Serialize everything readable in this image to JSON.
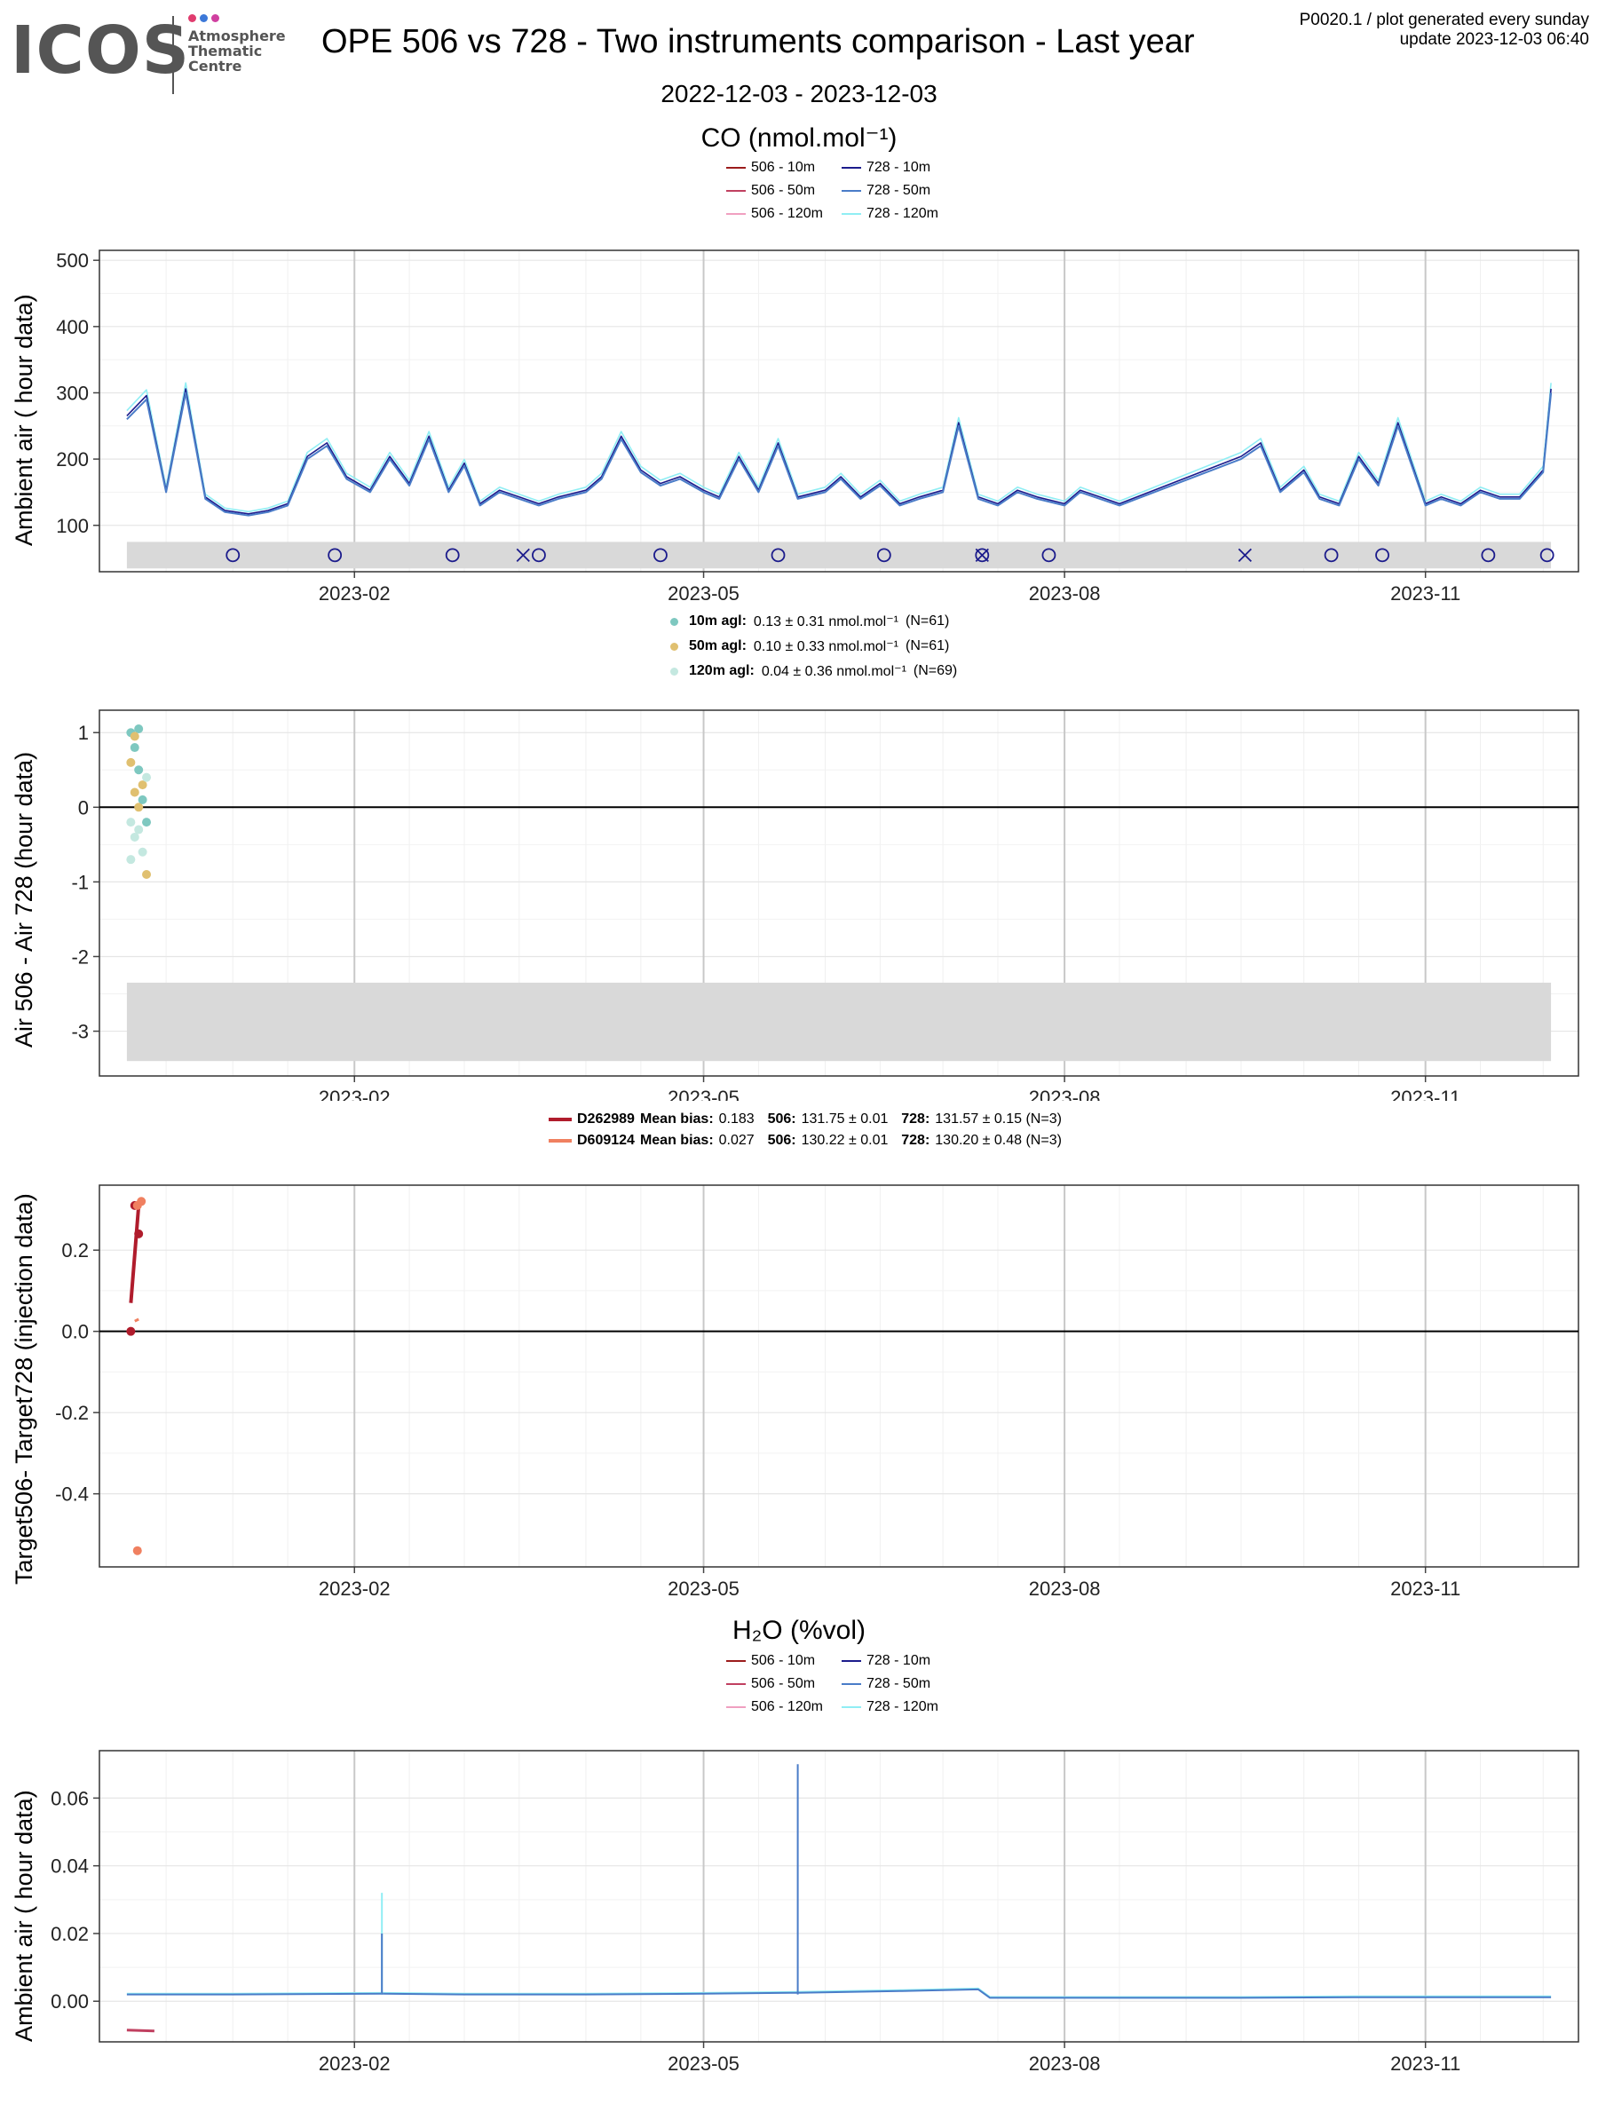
{
  "header": {
    "logo": "ICOS",
    "logo_sub": [
      "Atmosphere",
      "Thematic",
      "Centre"
    ],
    "logo_dot_colors": [
      "#e03c6e",
      "#3c78d8",
      "#d040a0"
    ],
    "title": "OPE 506 vs 728 - Two instruments comparison - Last year",
    "date_range": "2022-12-03 - 2023-12-03",
    "meta_line1": "P0020.1 / plot generated every sunday",
    "meta_line2": "update  2023-12-03 06:40"
  },
  "chart_data": [
    {
      "id": "co-ambient",
      "type": "line",
      "title": "CO (nmol.mol⁻¹)",
      "ylabel": "Ambient air ( hour data)",
      "ylim": [
        30,
        515
      ],
      "yticks": [
        100,
        200,
        300,
        400,
        500
      ],
      "xticks": [
        "2023-02",
        "2023-05",
        "2023-08",
        "2023-11"
      ],
      "legend": [
        {
          "name": "506 - 10m",
          "color": "#9b1c1c"
        },
        {
          "name": "728 - 10m",
          "color": "#1c1c8c"
        },
        {
          "name": "506 - 50m",
          "color": "#c04060"
        },
        {
          "name": "728 - 50m",
          "color": "#4a7cc8"
        },
        {
          "name": "506 - 120m",
          "color": "#f0a0c0"
        },
        {
          "name": "728 - 120m",
          "color": "#90eef4"
        }
      ],
      "series_728_50m": {
        "x": [
          "2022-12-05",
          "2022-12-10",
          "2022-12-15",
          "2022-12-20",
          "2022-12-25",
          "2022-12-30",
          "2023-01-05",
          "2023-01-10",
          "2023-01-15",
          "2023-01-20",
          "2023-01-25",
          "2023-01-30",
          "2023-02-05",
          "2023-02-10",
          "2023-02-15",
          "2023-02-20",
          "2023-02-25",
          "2023-03-01",
          "2023-03-05",
          "2023-03-10",
          "2023-03-15",
          "2023-03-20",
          "2023-03-25",
          "2023-04-01",
          "2023-04-05",
          "2023-04-10",
          "2023-04-15",
          "2023-04-20",
          "2023-04-25",
          "2023-05-01",
          "2023-05-05",
          "2023-05-10",
          "2023-05-15",
          "2023-05-20",
          "2023-05-25",
          "2023-06-01",
          "2023-06-05",
          "2023-06-10",
          "2023-06-15",
          "2023-06-20",
          "2023-06-25",
          "2023-07-01",
          "2023-07-05",
          "2023-07-10",
          "2023-07-15",
          "2023-07-20",
          "2023-07-25",
          "2023-08-01",
          "2023-08-05",
          "2023-08-10",
          "2023-08-15",
          "2023-09-15",
          "2023-09-20",
          "2023-09-25",
          "2023-10-01",
          "2023-10-05",
          "2023-10-10",
          "2023-10-15",
          "2023-10-20",
          "2023-10-25",
          "2023-11-01",
          "2023-11-05",
          "2023-11-10",
          "2023-11-15",
          "2023-11-20",
          "2023-11-25",
          "2023-12-01",
          "2023-12-03"
        ],
        "y": [
          260,
          290,
          150,
          300,
          140,
          120,
          115,
          120,
          130,
          200,
          220,
          170,
          150,
          200,
          160,
          230,
          150,
          190,
          130,
          150,
          140,
          130,
          140,
          150,
          170,
          230,
          180,
          160,
          170,
          150,
          140,
          200,
          150,
          220,
          140,
          150,
          170,
          140,
          160,
          130,
          140,
          150,
          250,
          140,
          130,
          150,
          140,
          130,
          150,
          140,
          130,
          200,
          220,
          150,
          180,
          140,
          130,
          200,
          160,
          250,
          130,
          140,
          130,
          150,
          140,
          140,
          180,
          300
        ]
      },
      "bias_band": [
        35,
        75
      ],
      "markers": {
        "circles": [
          "2023-01-01",
          "2023-01-27",
          "2023-02-26",
          "2023-03-20",
          "2023-04-20",
          "2023-05-20",
          "2023-06-16",
          "2023-07-11",
          "2023-07-28",
          "2023-10-08",
          "2023-10-21",
          "2023-11-17",
          "2023-12-02"
        ],
        "crosses": [
          "2023-03-16",
          "2023-07-11",
          "2023-09-16"
        ]
      }
    },
    {
      "id": "co-diff",
      "type": "scatter",
      "ylabel": "Air 506 - Air 728 (hour data)",
      "ylim": [
        -3.6,
        1.3
      ],
      "yticks": [
        -3,
        -2,
        -1,
        0,
        1
      ],
      "xticks": [
        "2023-02",
        "2023-05",
        "2023-08",
        "2023-11"
      ],
      "legend": [
        {
          "label_bold": "10m agl:",
          "label_text": "0.13 ± 0.31 nmol.mol⁻¹",
          "count": "(N=61)",
          "color": "#7ec8c0"
        },
        {
          "label_bold": "50m agl:",
          "label_text": "0.10 ± 0.33 nmol.mol⁻¹",
          "count": "(N=61)",
          "color": "#e0c070"
        },
        {
          "label_bold": "120m agl:",
          "label_text": "0.04 ± 0.36 nmol.mol⁻¹",
          "count": "(N=69)",
          "color": "#c4e8e0"
        }
      ],
      "bias_band": [
        -3.4,
        -2.35
      ],
      "points": {
        "x": [
          "2022-12-06",
          "2022-12-06",
          "2022-12-06",
          "2022-12-07",
          "2022-12-07",
          "2022-12-07",
          "2022-12-08",
          "2022-12-08",
          "2022-12-08",
          "2022-12-08",
          "2022-12-09",
          "2022-12-09",
          "2022-12-09",
          "2022-12-10",
          "2022-12-10",
          "2022-12-10",
          "2022-12-07",
          "2022-12-06"
        ],
        "y": [
          1.0,
          0.6,
          -0.2,
          0.8,
          0.2,
          -0.4,
          0.5,
          0.0,
          -0.3,
          1.05,
          0.3,
          -0.6,
          0.1,
          -0.9,
          0.4,
          -0.2,
          0.95,
          -0.7
        ]
      }
    },
    {
      "id": "co-target",
      "type": "line",
      "ylabel": "Target506- Target728 (injection data)",
      "ylim": [
        -0.58,
        0.36
      ],
      "yticks": [
        -0.4,
        -0.2,
        0.0,
        0.2
      ],
      "xticks": [
        "2023-02",
        "2023-05",
        "2023-08",
        "2023-11"
      ],
      "legend": [
        {
          "tank": "D262989",
          "mean_bias": "0.183",
          "v506": "131.75 ± 0.01",
          "v728": "131.57 ± 0.15 (N=3)",
          "color": "#b01c2c"
        },
        {
          "tank": "D609124",
          "mean_bias": "0.027",
          "v506": "130.22 ± 0.01",
          "v728": "130.20 ± 0.48 (N=3)",
          "color": "#f08060"
        }
      ],
      "tank1": {
        "x": [
          "2022-12-06",
          "2022-12-07",
          "2022-12-08"
        ],
        "y": [
          0.0,
          0.31,
          0.24
        ]
      },
      "tank1_line": {
        "x": [
          "2022-12-06",
          "2022-12-08"
        ],
        "y": [
          0.07,
          0.31
        ]
      },
      "tank2": {
        "x": [
          "2022-12-07",
          "2022-12-08",
          "2022-12-07"
        ],
        "y": [
          0.31,
          0.32,
          -0.54
        ]
      },
      "tank2_line": {
        "x": [
          "2022-12-07",
          "2022-12-08"
        ],
        "y": [
          0.025,
          0.03
        ]
      }
    },
    {
      "id": "h2o-ambient",
      "type": "line",
      "title": "H₂O (%vol)",
      "ylabel": "Ambient air ( hour data)",
      "ylim": [
        -0.012,
        0.074
      ],
      "yticks": [
        0.0,
        0.02,
        0.04,
        0.06
      ],
      "xticks": [
        "2023-02",
        "2023-05",
        "2023-08",
        "2023-11"
      ],
      "legend": [
        {
          "name": "506 - 10m",
          "color": "#9b1c1c"
        },
        {
          "name": "728 - 10m",
          "color": "#1c1c8c"
        },
        {
          "name": "506 - 50m",
          "color": "#c04060"
        },
        {
          "name": "728 - 50m",
          "color": "#4a7cc8"
        },
        {
          "name": "506 - 120m",
          "color": "#f0a0c0"
        },
        {
          "name": "728 - 120m",
          "color": "#90eef4"
        }
      ],
      "series_728_50m": {
        "x": [
          "2022-12-05",
          "2023-01-01",
          "2023-02-08",
          "2023-03-01",
          "2023-04-01",
          "2023-05-01",
          "2023-05-25",
          "2023-06-20",
          "2023-07-10",
          "2023-07-13",
          "2023-08-15",
          "2023-09-15",
          "2023-10-15",
          "2023-11-15",
          "2023-12-03"
        ],
        "y": [
          0.002,
          0.002,
          0.0022,
          0.002,
          0.002,
          0.0022,
          0.0025,
          0.003,
          0.0035,
          0.001,
          0.001,
          0.001,
          0.0012,
          0.0012,
          0.0012
        ]
      },
      "spikes": {
        "x": [
          "2023-02-08",
          "2023-05-25"
        ],
        "y": [
          0.02,
          0.07
        ]
      },
      "spikes_120m": {
        "x": [
          "2023-02-08"
        ],
        "y": [
          0.032
        ]
      },
      "series_506_10m": {
        "x": [
          "2022-12-05",
          "2022-12-12"
        ],
        "y": [
          -0.0085,
          -0.0088
        ]
      }
    }
  ]
}
